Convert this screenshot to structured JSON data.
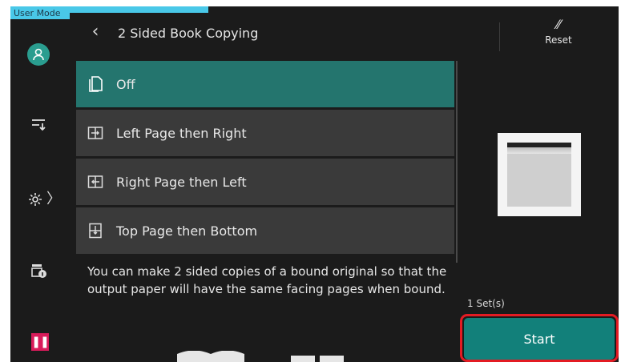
{
  "mode_tab": "User Mode",
  "header": {
    "title": "2 Sided Book Copying",
    "reset_label": "Reset"
  },
  "options": [
    {
      "label": "Off",
      "icon": "single-page-icon",
      "selected": true
    },
    {
      "label": "Left Page then Right",
      "icon": "left-right-pages-icon",
      "selected": false
    },
    {
      "label": "Right Page then Left",
      "icon": "right-left-pages-icon",
      "selected": false
    },
    {
      "label": "Top Page then Bottom",
      "icon": "top-bottom-pages-icon",
      "selected": false
    }
  ],
  "description": "You can make 2 sided copies of a bound original so that the output paper will have the same facing pages when bound.",
  "preview": {
    "sets": "1 Set(s)"
  },
  "start_label": "Start",
  "colors": {
    "selected": "#24756e",
    "start": "#12807a",
    "accent_outline": "#e31b23",
    "mode_tab": "#49c8e8",
    "pause": "#d81b5a"
  }
}
